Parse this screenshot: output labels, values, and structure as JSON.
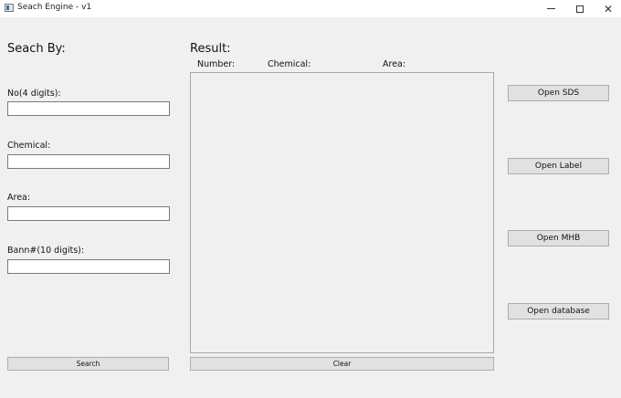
{
  "window": {
    "title": "Seach Engine - v1",
    "icon": "app-window-icon",
    "controls": {
      "minimize": "minimize-icon",
      "maximize": "maximize-icon",
      "close": "close-icon"
    }
  },
  "search_panel": {
    "heading": "Seach By:",
    "fields": [
      {
        "label": "No(4 digits):",
        "value": ""
      },
      {
        "label": "Chemical:",
        "value": ""
      },
      {
        "label": "Area:",
        "value": ""
      },
      {
        "label": "Bann#(10 digits):",
        "value": ""
      }
    ],
    "search_label": "Search"
  },
  "result_panel": {
    "heading": "Result:",
    "columns": [
      "Number:",
      "Chemical:",
      "Area:"
    ],
    "rows": [],
    "clear_label": "Clear"
  },
  "actions": {
    "open_sds": "Open SDS",
    "open_label": "Open Label",
    "open_mhb": "Open MHB",
    "open_database": "Open database"
  }
}
